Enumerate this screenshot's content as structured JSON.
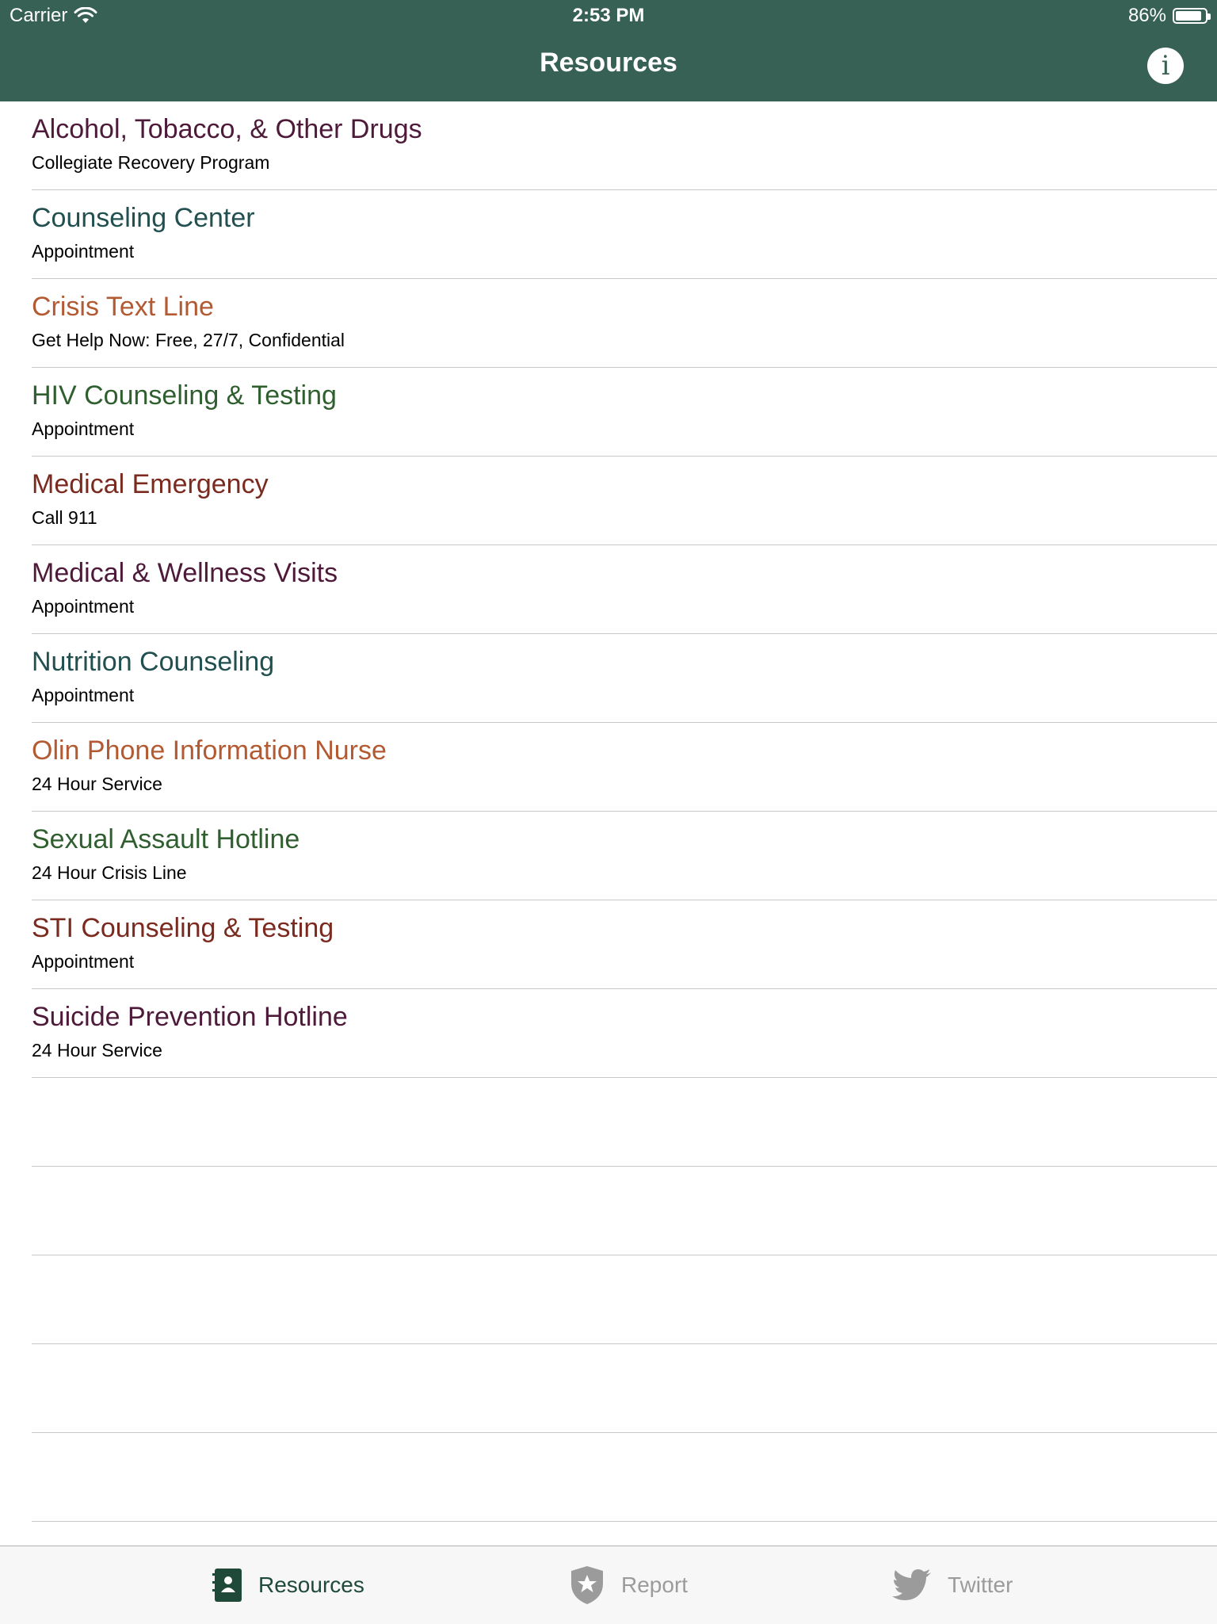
{
  "status_bar": {
    "carrier": "Carrier",
    "time": "2:53 PM",
    "battery": "86%"
  },
  "nav": {
    "title": "Resources",
    "info_icon": "i"
  },
  "items": [
    {
      "title": "Alcohol, Tobacco, & Other Drugs",
      "subtitle": "Collegiate Recovery Program",
      "color": "#4e1a3a"
    },
    {
      "title": "Counseling Center",
      "subtitle": "Appointment",
      "color": "#224f4f"
    },
    {
      "title": "Crisis Text Line",
      "subtitle": "Get Help Now: Free, 27/7, Confidential",
      "color": "#b35a33"
    },
    {
      "title": "HIV Counseling & Testing",
      "subtitle": "Appointment",
      "color": "#2f5f2f"
    },
    {
      "title": "Medical Emergency",
      "subtitle": "Call 911",
      "color": "#7a2a1f"
    },
    {
      "title": "Medical & Wellness Visits",
      "subtitle": "Appointment",
      "color": "#4e1a3a"
    },
    {
      "title": "Nutrition Counseling",
      "subtitle": "Appointment",
      "color": "#224f4f"
    },
    {
      "title": "Olin Phone Information Nurse",
      "subtitle": "24 Hour Service",
      "color": "#b35a33"
    },
    {
      "title": "Sexual Assault Hotline",
      "subtitle": "24 Hour Crisis Line",
      "color": "#2f5f2f"
    },
    {
      "title": "STI Counseling & Testing",
      "subtitle": "Appointment",
      "color": "#7a2a1f"
    },
    {
      "title": "Suicide Prevention Hotline",
      "subtitle": "24 Hour Service",
      "color": "#4e1a3a"
    }
  ],
  "tabs": [
    {
      "label": "Resources",
      "icon": "contacts-book-icon",
      "active": true
    },
    {
      "label": "Report",
      "icon": "shield-star-icon",
      "active": false
    },
    {
      "label": "Twitter",
      "icon": "twitter-bird-icon",
      "active": false
    }
  ]
}
